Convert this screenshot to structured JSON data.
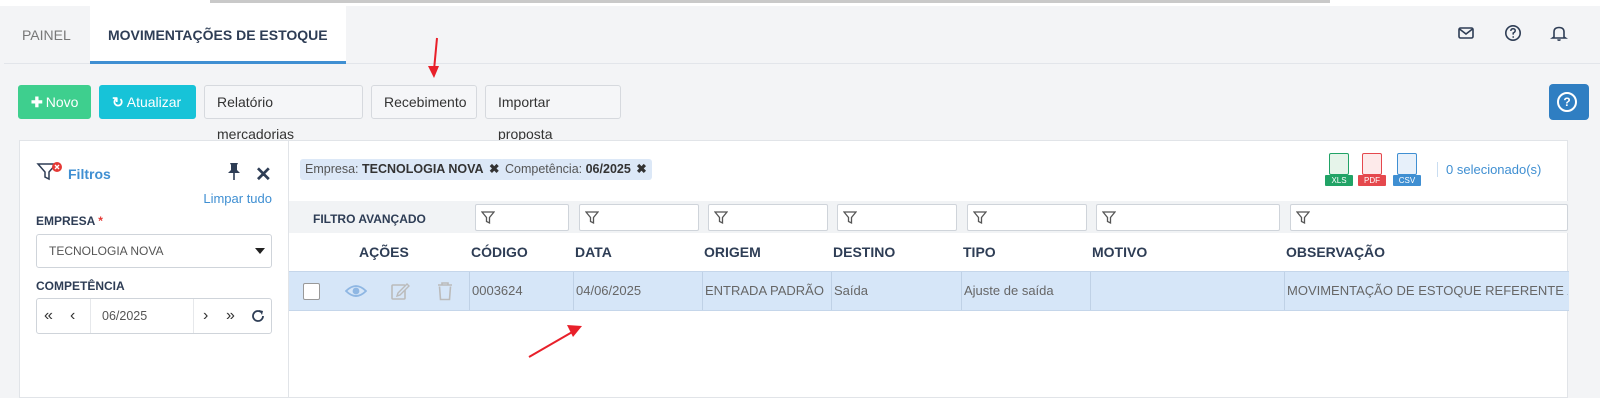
{
  "tabs": [
    {
      "label": "PAINEL",
      "active": false
    },
    {
      "label": "MOVIMENTAÇÕES DE ESTOQUE",
      "active": true
    }
  ],
  "header_icons": [
    "mail-icon",
    "help-circle-icon",
    "bell-icon"
  ],
  "toolbar": {
    "new_label": "Novo",
    "refresh_label": "Atualizar",
    "report_label": "Relatório mercadorias",
    "receive_label": "Recebimento",
    "import_label": "Importar proposta"
  },
  "filters": {
    "title": "Filtros",
    "clear_all": "Limpar tudo",
    "empresa_label": "EMPRESA",
    "empresa_required": "*",
    "empresa_value": "TECNOLOGIA NOVA",
    "competencia_label": "COMPETÊNCIA",
    "competencia_value": "06/2025"
  },
  "chips": [
    {
      "key": "Empresa:",
      "value": "TECNOLOGIA NOVA"
    },
    {
      "key": "Competência:",
      "value": "06/2025"
    }
  ],
  "exports": [
    {
      "name": "xls",
      "label": "XLS",
      "color": "#21a366"
    },
    {
      "name": "pdf",
      "label": "PDF",
      "color": "#e5484d"
    },
    {
      "name": "csv",
      "label": "CSV",
      "color": "#3f8fd2"
    }
  ],
  "selected_count": "0 selecionado(s)",
  "advanced_filter_label": "FILTRO AVANÇADO",
  "columns": [
    "AÇÕES",
    "CÓDIGO",
    "DATA",
    "ORIGEM",
    "DESTINO",
    "TIPO",
    "MOTIVO",
    "OBSERVAÇÃO"
  ],
  "rows": [
    {
      "codigo": "0003624",
      "data": "04/06/2025",
      "origem": "ENTRADA PADRÃO",
      "destino": "Saída",
      "tipo": "Ajuste de saída",
      "motivo": "",
      "observacao": "MOVIMENTAÇÃO DE ESTOQUE REFERENTE À NF"
    }
  ],
  "colors": {
    "accent": "#3f8fd2",
    "green": "#3ecf8e",
    "cyan": "#17c3d8",
    "row_selected": "#d6e6f8",
    "annotation_arrow": "#e8202a"
  }
}
